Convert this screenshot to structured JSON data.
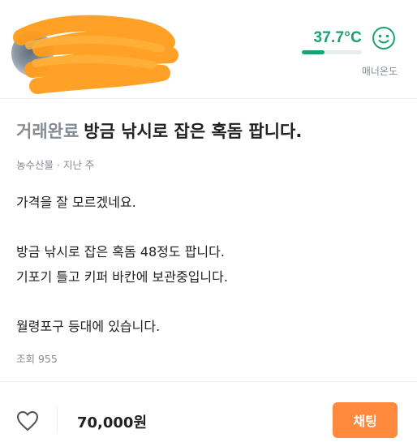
{
  "seller": {
    "avatar_name": "avatar",
    "manner": {
      "temperature": "37.7°C",
      "level_percent": 38,
      "label": "매너온도",
      "color": "#1aa174",
      "face_icon": "smiling-face-icon"
    }
  },
  "article": {
    "status": "거래완료",
    "title": "방금 낚시로 잡은 혹돔 팝니다.",
    "category": "농수산물",
    "separator": " · ",
    "time": "지난 주",
    "body_lines": [
      "가격을 잘 모르겠네요.",
      "방금 낚시로 잡은 혹돔 48정도 팝니다.",
      "기포기 틀고 키퍼 바칸에 보관중입니다.",
      "월령포구 등대에 있습니다."
    ],
    "views": "조회 955"
  },
  "bottom_bar": {
    "heart_icon": "heart-outline-icon",
    "price": "70,000원",
    "chat_label": "채팅",
    "chat_color": "#ff8a3d"
  }
}
